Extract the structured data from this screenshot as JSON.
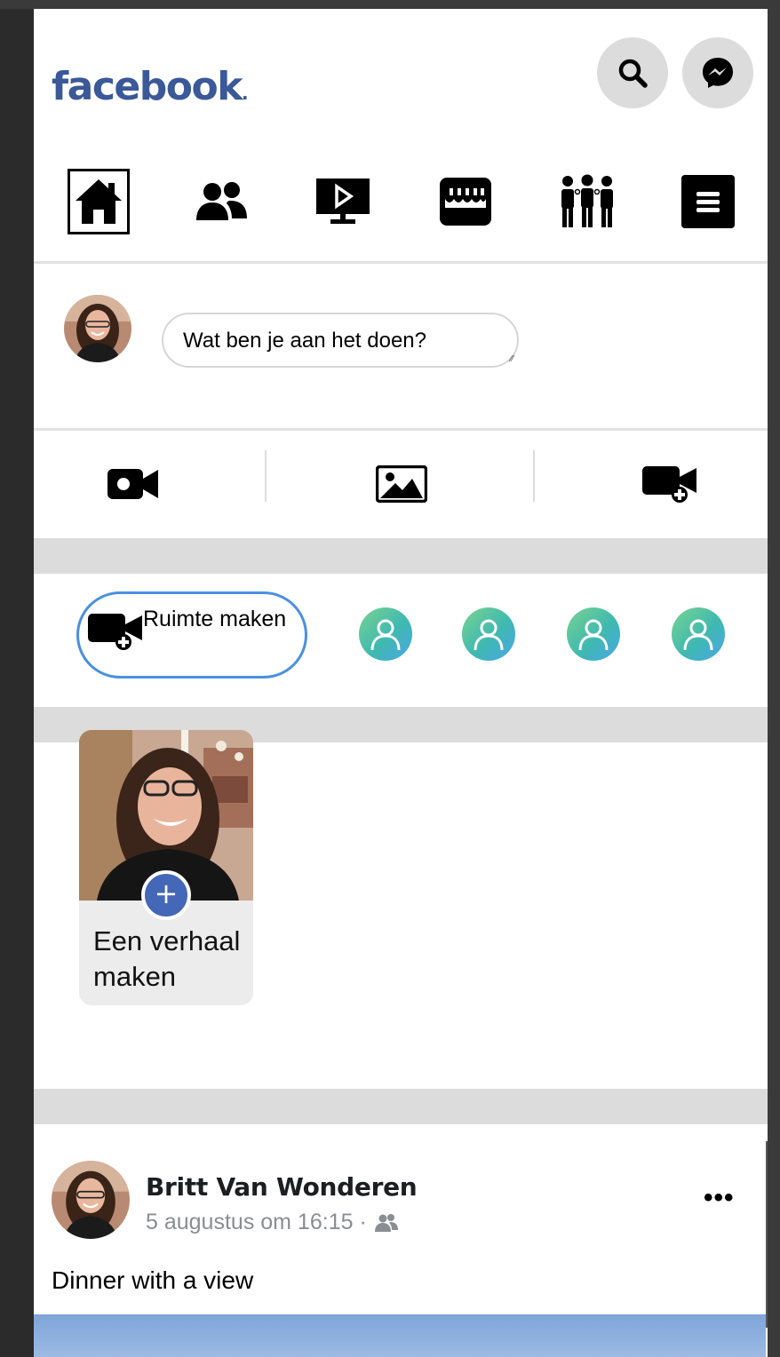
{
  "header": {
    "logo_text": "facebook",
    "search_icon": "search-icon",
    "messenger_icon": "messenger-icon"
  },
  "nav": {
    "items": [
      {
        "icon": "home-icon",
        "active": true
      },
      {
        "icon": "friends-icon",
        "active": false
      },
      {
        "icon": "watch-icon",
        "active": false
      },
      {
        "icon": "marketplace-icon",
        "active": false
      },
      {
        "icon": "groups-icon",
        "active": false
      },
      {
        "icon": "menu-icon",
        "active": false
      }
    ]
  },
  "composer": {
    "placeholder": "Wat ben je aan het doen?"
  },
  "media_actions": {
    "icons": [
      "live-video-icon",
      "photo-icon",
      "create-room-icon"
    ]
  },
  "rooms": {
    "create_label": "Ruimte maken",
    "contacts_count": 4
  },
  "stories": {
    "create_label": "Een verhaal maken",
    "plus": "+"
  },
  "post": {
    "author": "Britt Van Wonderen",
    "timestamp": "5 augustus om 16:15 ·",
    "audience_icon": "friends-audience-icon",
    "more": "•••",
    "text": "Dinner with a view"
  },
  "colors": {
    "brand": "#3b5998",
    "accent_blue": "#4a90e2",
    "story_plus": "#4567b7"
  }
}
